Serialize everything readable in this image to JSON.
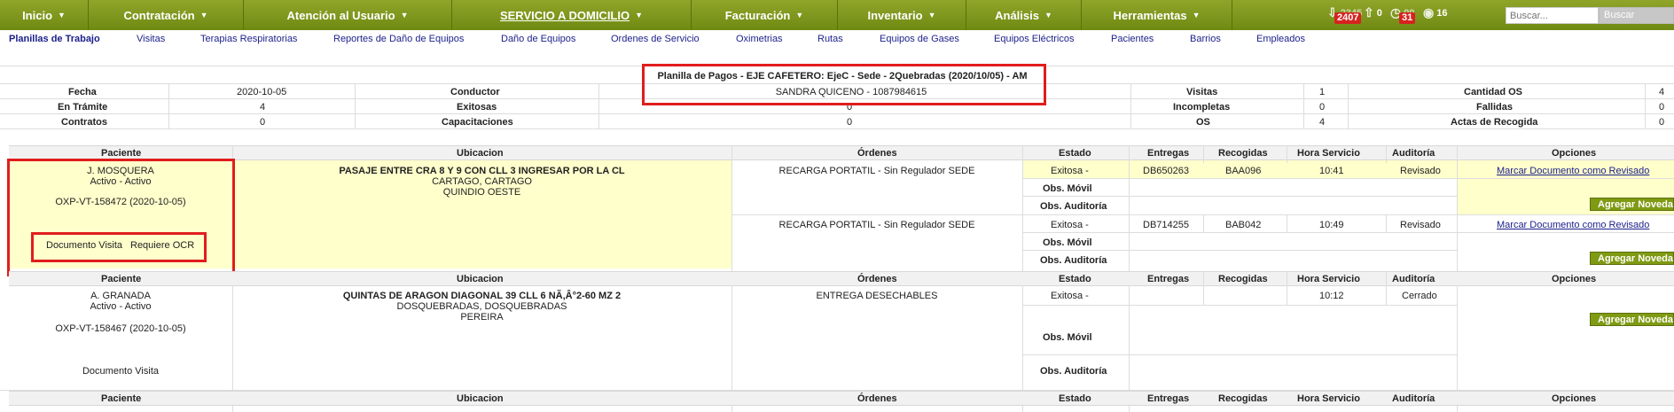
{
  "nav": {
    "items": [
      {
        "label": "Inicio"
      },
      {
        "label": "Contratación"
      },
      {
        "label": "Atención al Usuario"
      },
      {
        "label": "SERVICIO A DOMICILIO"
      },
      {
        "label": "Facturación"
      },
      {
        "label": "Inventario"
      },
      {
        "label": "Análisis"
      },
      {
        "label": "Herramientas"
      }
    ],
    "notifications": [
      {
        "label": "2345",
        "badge": "2407",
        "icon": "download-icon"
      },
      {
        "label": "0",
        "icon": "upload-icon"
      },
      {
        "label": "99",
        "badge": "31",
        "icon": "clock-icon"
      },
      {
        "label": "16",
        "icon": "eye-icon"
      }
    ],
    "search_placeholder": "Buscar...",
    "search_button": "Buscar"
  },
  "subnav": [
    "Planillas de Trabajo",
    "Visitas",
    "Terapias Respiratorias",
    "Reportes de Daño de Equipos",
    "Daño de Equipos",
    "Ordenes de Servicio",
    "Oximetrias",
    "Rutas",
    "Equipos de Gases",
    "Equipos Eléctricos",
    "Pacientes",
    "Barrios",
    "Empleados"
  ],
  "summary": {
    "title": "Planilla de Pagos - EJE CAFETERO: EjeC - Sede - 2Quebradas (2020/10/05) - AM",
    "fecha_label": "Fecha",
    "fecha": "2020-10-05",
    "conductor_label": "Conductor",
    "conductor": "SANDRA QUICENO - 1087984615",
    "visitas_label": "Visitas",
    "visitas": "1",
    "cantidad_os_label": "Cantidad OS",
    "cantidad_os": "4",
    "tramite_label": "En Trámite",
    "tramite": "4",
    "exitosas_label": "Exitosas",
    "exitosas": "0",
    "incompletas_label": "Incompletas",
    "incompletas": "0",
    "fallidas_label": "Fallidas",
    "fallidas": "0",
    "contratos_label": "Contratos",
    "contratos": "0",
    "capacitaciones_label": "Capacitaciones",
    "capacitaciones": "0",
    "os_label": "OS",
    "os": "4",
    "actas_label": "Actas de Recogida",
    "actas": "0"
  },
  "columns": [
    "Paciente",
    "Ubicacion",
    "Órdenes",
    "Estado",
    "Entregas",
    "Recogidas",
    "Hora Servicio",
    "Auditoría",
    "Opciones"
  ],
  "rows": [
    {
      "paciente": "J. MOSQUERA",
      "estado_pac": "Activo - Activo",
      "codigo": "OXP-VT-158472 (2020-10-05)",
      "documento": "Documento Visita",
      "ocr": "Requiere OCR",
      "ubic1": "PASAJE ENTRE CRA 8 Y 9 CON CLL 3 INGRESAR POR LA CL",
      "ubic2": "CARTAGO, CARTAGO",
      "ubic3": "QUINDIO OESTE",
      "ordenes": [
        {
          "orden": "RECARGA PORTATIL - Sin Regulador SEDE",
          "estado": "Exitosa -",
          "entrega": "DB650263",
          "recogida": "BAA096",
          "hora": "10:41",
          "auditoria": "Revisado",
          "opcion": "Marcar Documento como Revisado"
        },
        {
          "orden": "RECARGA PORTATIL - Sin Regulador SEDE",
          "estado": "Exitosa -",
          "entrega": "DB714255",
          "recogida": "BAB042",
          "hora": "10:49",
          "auditoria": "Revisado",
          "opcion": "Marcar Documento como Revisado"
        }
      ],
      "obs_movil": "Obs. Móvil",
      "obs_auditoria": "Obs. Auditoría",
      "boton": "Agregar Novedad"
    },
    {
      "paciente": "A. GRANADA",
      "estado_pac": "Activo - Activo",
      "codigo": "OXP-VT-158467 (2020-10-05)",
      "documento": "Documento Visita",
      "ubic1": "QUINTAS DE ARAGON DIAGONAL 39 CLL 6 NÃ‚Â°2-60 MZ 2",
      "ubic2": "DOSQUEBRADAS, DOSQUEBRADAS",
      "ubic3": "PEREIRA",
      "orden": "ENTREGA DESECHABLES",
      "estado": "Exitosa -",
      "hora": "10:12",
      "auditoria": "Cerrado",
      "obs_movil": "Obs. Móvil",
      "obs_auditoria": "Obs. Auditoría",
      "boton": "Agregar Novedad"
    }
  ],
  "colors": {
    "nav": "#7f9a13",
    "highlight": "#ffffcc",
    "annotation": "#e11d1d",
    "link": "#1b1f8a"
  }
}
